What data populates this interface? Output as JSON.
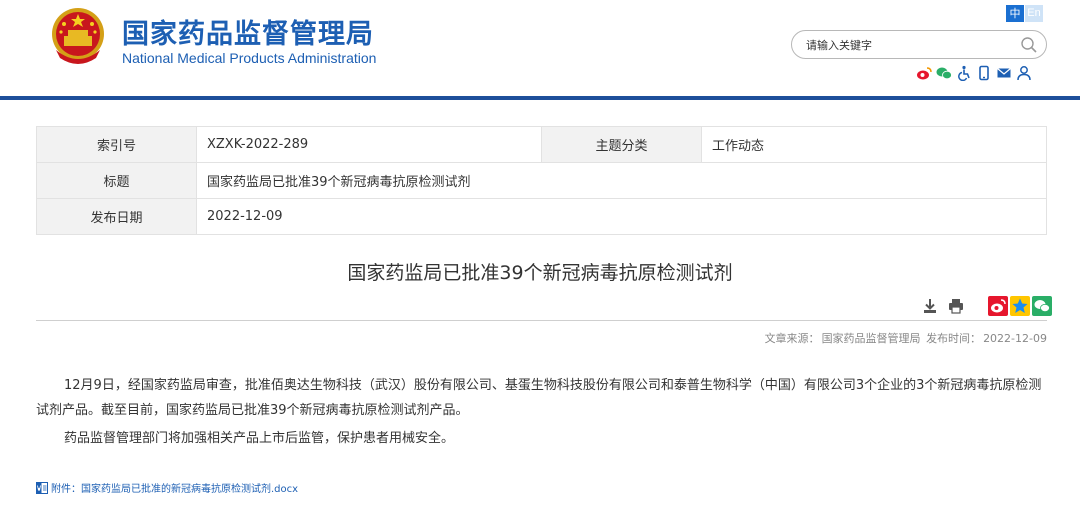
{
  "header": {
    "site_name_cn": "国家药品监督管理局",
    "site_name_en": "National Medical Products Administration",
    "lang_zh": "中",
    "lang_en": "En",
    "search_placeholder": "请输入关键字",
    "icons": [
      "weibo-icon",
      "wechat-icon",
      "accessibility-icon",
      "mobile-icon",
      "mail-icon",
      "user-icon"
    ],
    "brand_color": "#1d5fb3"
  },
  "meta": {
    "index_label": "索引号",
    "index_value": "XZXK-2022-289",
    "category_label": "主题分类",
    "category_value": "工作动态",
    "title_label": "标题",
    "title_value": "国家药监局已批准39个新冠病毒抗原检测试剂",
    "date_label": "发布日期",
    "date_value": "2022-12-09"
  },
  "article": {
    "title": "国家药监局已批准39个新冠病毒抗原检测试剂",
    "source_label": "文章来源：",
    "source_value": "国家药品监督管理局",
    "time_label": "发布时间：",
    "time_value": "2022-12-09",
    "paragraphs": [
      "12月9日，经国家药监局审查，批准佰奥达生物科技（武汉）股份有限公司、基蛋生物科技股份有限公司和泰普生物科学（中国）有限公司3个企业的3个新冠病毒抗原检测试剂产品。截至目前，国家药监局已批准39个新冠病毒抗原检测试剂产品。",
      "药品监督管理部门将加强相关产品上市后监管，保护患者用械安全。"
    ],
    "attachment": "附件：国家药监局已批准的新冠病毒抗原检测试剂.docx"
  }
}
